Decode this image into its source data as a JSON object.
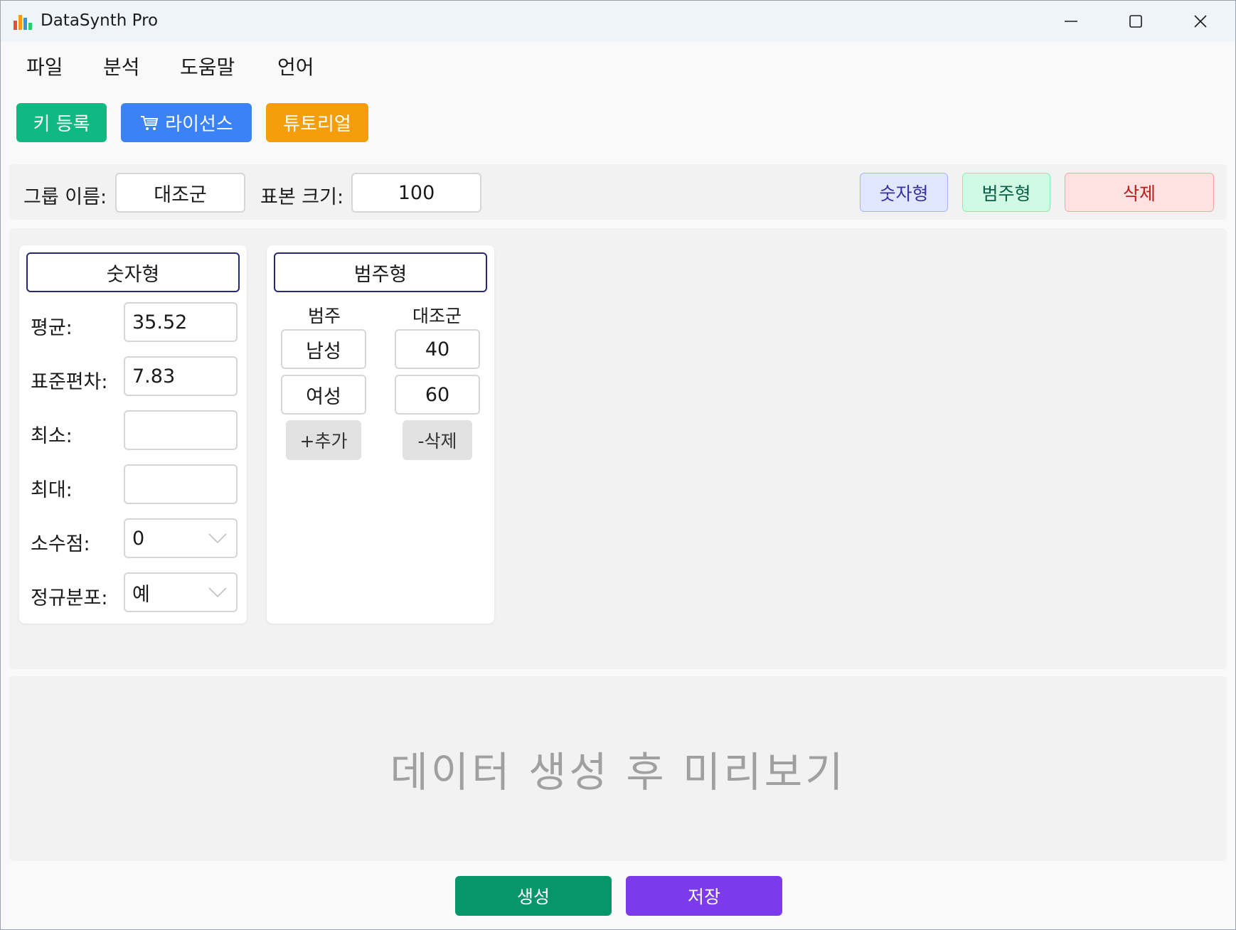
{
  "window": {
    "title": "DataSynth Pro"
  },
  "menu": {
    "items": [
      "파일",
      "분석",
      "도움말",
      "언어"
    ]
  },
  "toolbar": {
    "key_register": "키 등록",
    "license": "라이선스",
    "tutorial": "튜토리얼"
  },
  "group": {
    "name_label": "그룹 이름:",
    "name_value": "대조군",
    "size_label": "표본 크기:",
    "size_value": "100",
    "numeric_btn": "숫자형",
    "categorical_btn": "범주형",
    "delete_btn": "삭제"
  },
  "numeric_card": {
    "title": "숫자형",
    "mean_label": "평균:",
    "mean_value": "35.52",
    "sd_label": "표준편차:",
    "sd_value": "7.83",
    "min_label": "최소:",
    "min_value": "",
    "max_label": "최대:",
    "max_value": "",
    "decimal_label": "소수점:",
    "decimal_value": "0",
    "normal_label": "정규분포:",
    "normal_value": "예"
  },
  "categorical_card": {
    "title": "범주형",
    "col_category": "범주",
    "col_group": "대조군",
    "rows": [
      {
        "category": "남성",
        "value": "40"
      },
      {
        "category": "여성",
        "value": "60"
      }
    ],
    "add_btn": "+추가",
    "remove_btn": "-삭제"
  },
  "preview": {
    "placeholder": "데이터 생성 후 미리보기"
  },
  "actions": {
    "generate": "생성",
    "save": "저장"
  },
  "colors": {
    "key_register": "#10b981",
    "license": "#3b82f6",
    "tutorial": "#f59e0b",
    "generate": "#059669",
    "save": "#7c3aed"
  }
}
